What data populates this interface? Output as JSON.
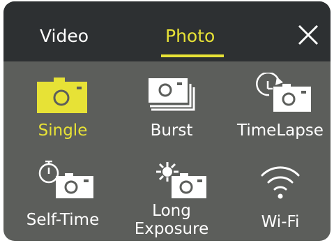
{
  "header": {
    "tabs": [
      {
        "label": "Video"
      },
      {
        "label": "Photo"
      }
    ]
  },
  "menu": {
    "items": [
      {
        "label": "Single"
      },
      {
        "label": "Burst"
      },
      {
        "label": "TimeLapse"
      },
      {
        "label": "Self-Time"
      },
      {
        "label_line1": "Long",
        "label_line2": "Exposure"
      },
      {
        "label": "Wi-Fi"
      }
    ]
  },
  "colors": {
    "accent": "#e7e236",
    "topbar": "#2d3032",
    "background": "#5c5e5b",
    "text": "#ffffff"
  },
  "icons": [
    "close-icon",
    "camera-icon",
    "burst-icon",
    "timelapse-icon",
    "self-timer-icon",
    "long-exposure-icon",
    "wifi-icon"
  ]
}
